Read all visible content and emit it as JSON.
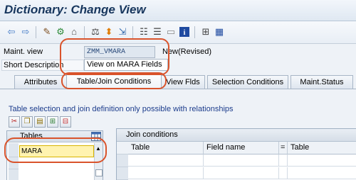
{
  "window": {
    "title": "Dictionary: Change View"
  },
  "toolbar": {
    "icons": [
      "back-arrow-icon",
      "forward-arrow-icon",
      "display-change-icon",
      "other-object-icon",
      "activate-icon",
      "check-icon",
      "where-used-icon",
      "test-icon",
      "object-list-icon",
      "hierarchy-icon",
      "display-object-list-icon",
      "info-icon",
      "technical-settings-icon",
      "table-icon"
    ]
  },
  "header": {
    "maint_view_label": "Maint. view",
    "maint_view_value": "ZMM_VMARA",
    "status": "New(Revised)",
    "short_desc_label": "Short Description",
    "short_desc_value": "View on MARA Fields"
  },
  "tabs": [
    {
      "label": "Attributes",
      "active": false
    },
    {
      "label": "Table/Join Conditions",
      "active": true
    },
    {
      "label": "View Flds",
      "active": false
    },
    {
      "label": "Selection Conditions",
      "active": false
    },
    {
      "label": "Maint.Status",
      "active": false
    }
  ],
  "panel": {
    "info_text": "Table selection and join definition only possible with relationships",
    "tables_header": "Tables",
    "tables_value": "MARA",
    "joins_title": "Join conditions",
    "join_columns": [
      "Table",
      "Field name",
      "=",
      "Table"
    ]
  },
  "colors": {
    "highlight": "#d9532b",
    "title": "#17365d",
    "info_text": "#1c3c8c"
  }
}
